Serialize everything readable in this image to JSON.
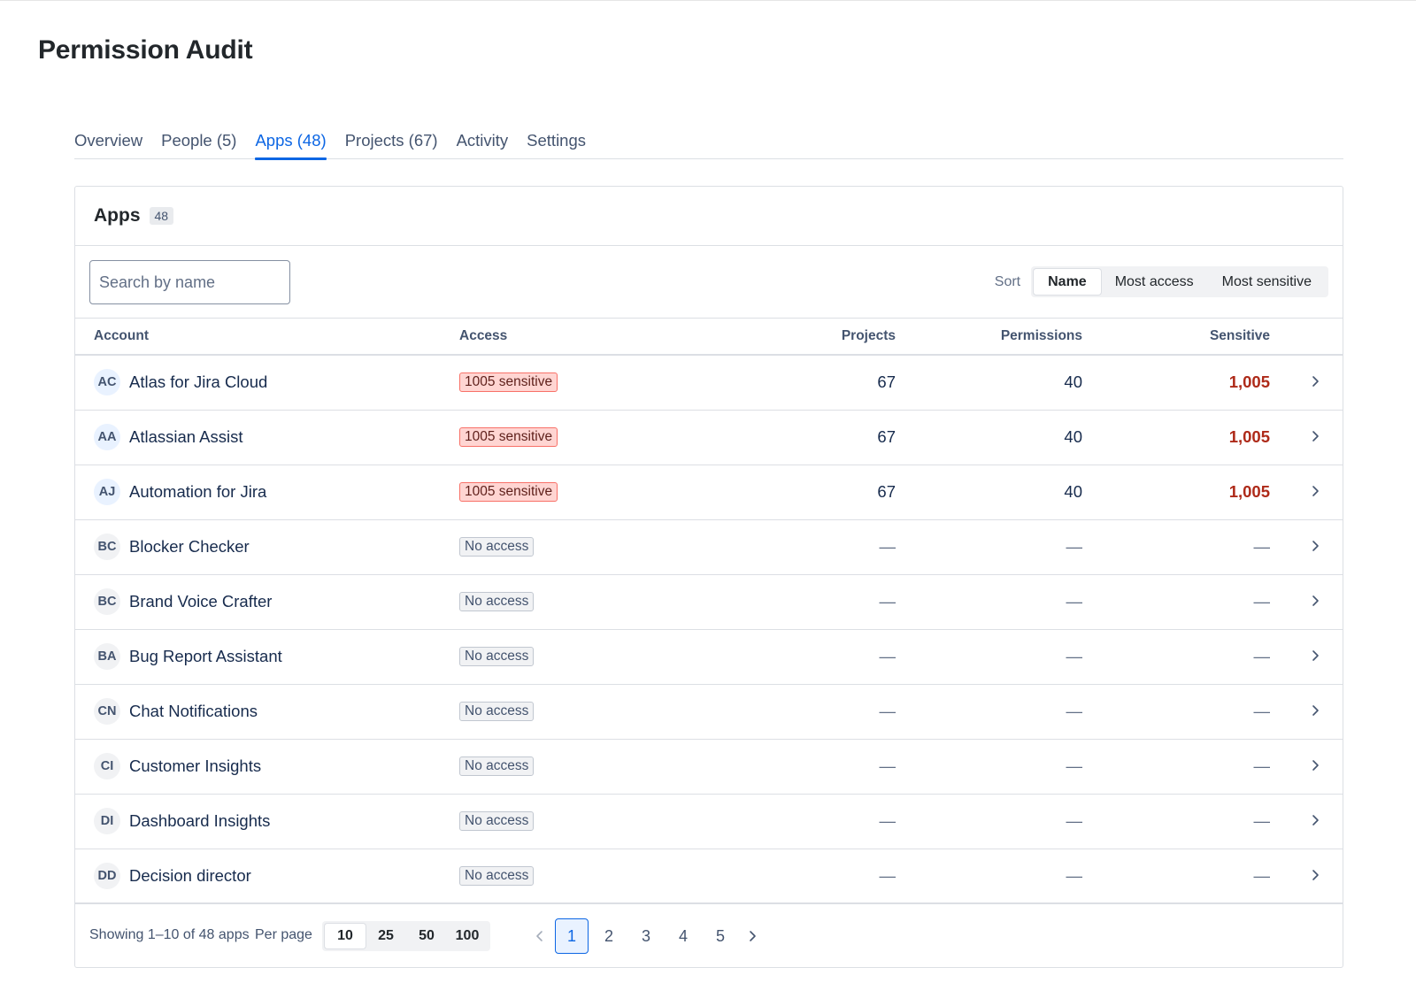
{
  "page": {
    "title": "Permission Audit"
  },
  "tabs": [
    {
      "label": "Overview",
      "active": false
    },
    {
      "label": "People (5)",
      "active": false
    },
    {
      "label": "Apps (48)",
      "active": true
    },
    {
      "label": "Projects (67)",
      "active": false
    },
    {
      "label": "Activity",
      "active": false
    },
    {
      "label": "Settings",
      "active": false
    }
  ],
  "card": {
    "title": "Apps",
    "count": "48"
  },
  "search": {
    "placeholder": "Search by name",
    "value": ""
  },
  "sort": {
    "label": "Sort",
    "options": [
      "Name",
      "Most access",
      "Most sensitive"
    ],
    "selected": "Name"
  },
  "table": {
    "headers": {
      "account": "Account",
      "access": "Access",
      "projects": "Projects",
      "permissions": "Permissions",
      "sensitive": "Sensitive"
    },
    "rows": [
      {
        "initials": "AC",
        "name": "Atlas for Jira Cloud",
        "access": "1005 sensitive",
        "access_type": "danger",
        "projects": "67",
        "permissions": "40",
        "sensitive": "1,005"
      },
      {
        "initials": "AA",
        "name": "Atlassian Assist",
        "access": "1005 sensitive",
        "access_type": "danger",
        "projects": "67",
        "permissions": "40",
        "sensitive": "1,005"
      },
      {
        "initials": "AJ",
        "name": "Automation for Jira",
        "access": "1005 sensitive",
        "access_type": "danger",
        "projects": "67",
        "permissions": "40",
        "sensitive": "1,005"
      },
      {
        "initials": "BC",
        "name": "Blocker Checker",
        "access": "No access",
        "access_type": "neutral",
        "projects": "—",
        "permissions": "—",
        "sensitive": "—"
      },
      {
        "initials": "BC",
        "name": "Brand Voice Crafter",
        "access": "No access",
        "access_type": "neutral",
        "projects": "—",
        "permissions": "—",
        "sensitive": "—"
      },
      {
        "initials": "BA",
        "name": "Bug Report Assistant",
        "access": "No access",
        "access_type": "neutral",
        "projects": "—",
        "permissions": "—",
        "sensitive": "—"
      },
      {
        "initials": "CN",
        "name": "Chat Notifications",
        "access": "No access",
        "access_type": "neutral",
        "projects": "—",
        "permissions": "—",
        "sensitive": "—"
      },
      {
        "initials": "CI",
        "name": "Customer Insights",
        "access": "No access",
        "access_type": "neutral",
        "projects": "—",
        "permissions": "—",
        "sensitive": "—"
      },
      {
        "initials": "DI",
        "name": "Dashboard Insights",
        "access": "No access",
        "access_type": "neutral",
        "projects": "—",
        "permissions": "—",
        "sensitive": "—"
      },
      {
        "initials": "DD",
        "name": "Decision director",
        "access": "No access",
        "access_type": "neutral",
        "projects": "—",
        "permissions": "—",
        "sensitive": "—"
      }
    ]
  },
  "footer": {
    "showing": "Showing 1–10 of 48 apps",
    "per_page_label": "Per page",
    "per_page_options": [
      "10",
      "25",
      "50",
      "100"
    ],
    "per_page_selected": "10",
    "pages": [
      "1",
      "2",
      "3",
      "4",
      "5"
    ],
    "current_page": "1"
  },
  "colors": {
    "accent": "#0c66e4",
    "danger": "#ae2a19",
    "danger_bg": "#ffd5d2"
  },
  "icons": {
    "row_action": "chevron-right-icon",
    "prev": "chevron-left-icon",
    "next": "chevron-right-icon"
  }
}
